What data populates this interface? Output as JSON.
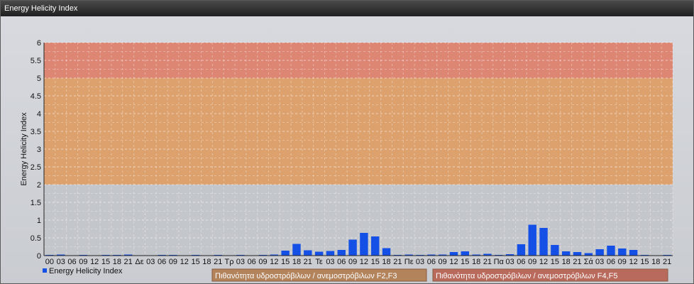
{
  "window": {
    "title": "Energy Helicity Index"
  },
  "chart_data": {
    "type": "bar",
    "title": "Energy Helicity Index",
    "ylabel": "Energy Helicity Index",
    "xlabel": "",
    "ylim": [
      0,
      6
    ],
    "yticks": [
      "0",
      "0.5",
      "1",
      "1.5",
      "2",
      "2.5",
      "3",
      "3.5",
      "4",
      "4.5",
      "5",
      "5.5",
      "6"
    ],
    "grid": true,
    "categories": [
      "00",
      "03",
      "06",
      "09",
      "12",
      "15",
      "18",
      "21",
      "Δε",
      "03",
      "06",
      "09",
      "12",
      "15",
      "18",
      "21",
      "Τρ",
      "03",
      "06",
      "09",
      "12",
      "15",
      "18",
      "21",
      "Τε",
      "03",
      "06",
      "09",
      "12",
      "15",
      "18",
      "21",
      "Πε",
      "03",
      "06",
      "09",
      "12",
      "15",
      "18",
      "21",
      "Πα",
      "03",
      "06",
      "09",
      "12",
      "15",
      "18",
      "21",
      "Σά",
      "03",
      "06",
      "09",
      "12",
      "15",
      "18",
      "21"
    ],
    "series": [
      {
        "name": "Energy Helicity Index",
        "color": "#1450e6",
        "values": [
          0.02,
          0.03,
          0.01,
          0.02,
          0.01,
          0.02,
          0.02,
          0.03,
          0.01,
          0.01,
          0.02,
          0.02,
          0.01,
          0.02,
          0.01,
          0.02,
          0.01,
          0.02,
          0.01,
          0.02,
          0.03,
          0.14,
          0.33,
          0.15,
          0.11,
          0.13,
          0.16,
          0.45,
          0.64,
          0.54,
          0.21,
          0.02,
          0.03,
          0.02,
          0.03,
          0.03,
          0.1,
          0.12,
          0.03,
          0.05,
          0.02,
          0.04,
          0.32,
          0.87,
          0.78,
          0.3,
          0.12,
          0.1,
          0.07,
          0.18,
          0.28,
          0.2,
          0.16,
          0.02,
          0.01,
          0.02
        ]
      }
    ],
    "bands": [
      {
        "from": 2,
        "to": 5,
        "color": "#e09a5c",
        "label": "Πιθανότητα υδροστρόβιλων / ανεμοστρόβιλων F2,F3"
      },
      {
        "from": 5,
        "to": 6,
        "color": "#e07a64",
        "label": "Πιθανότητα υδροστρόβιλων / ανεμοστρόβιλων F4,F5"
      }
    ],
    "legend": {
      "placement": "bottom-left",
      "label": "Energy Helicity Index"
    }
  }
}
